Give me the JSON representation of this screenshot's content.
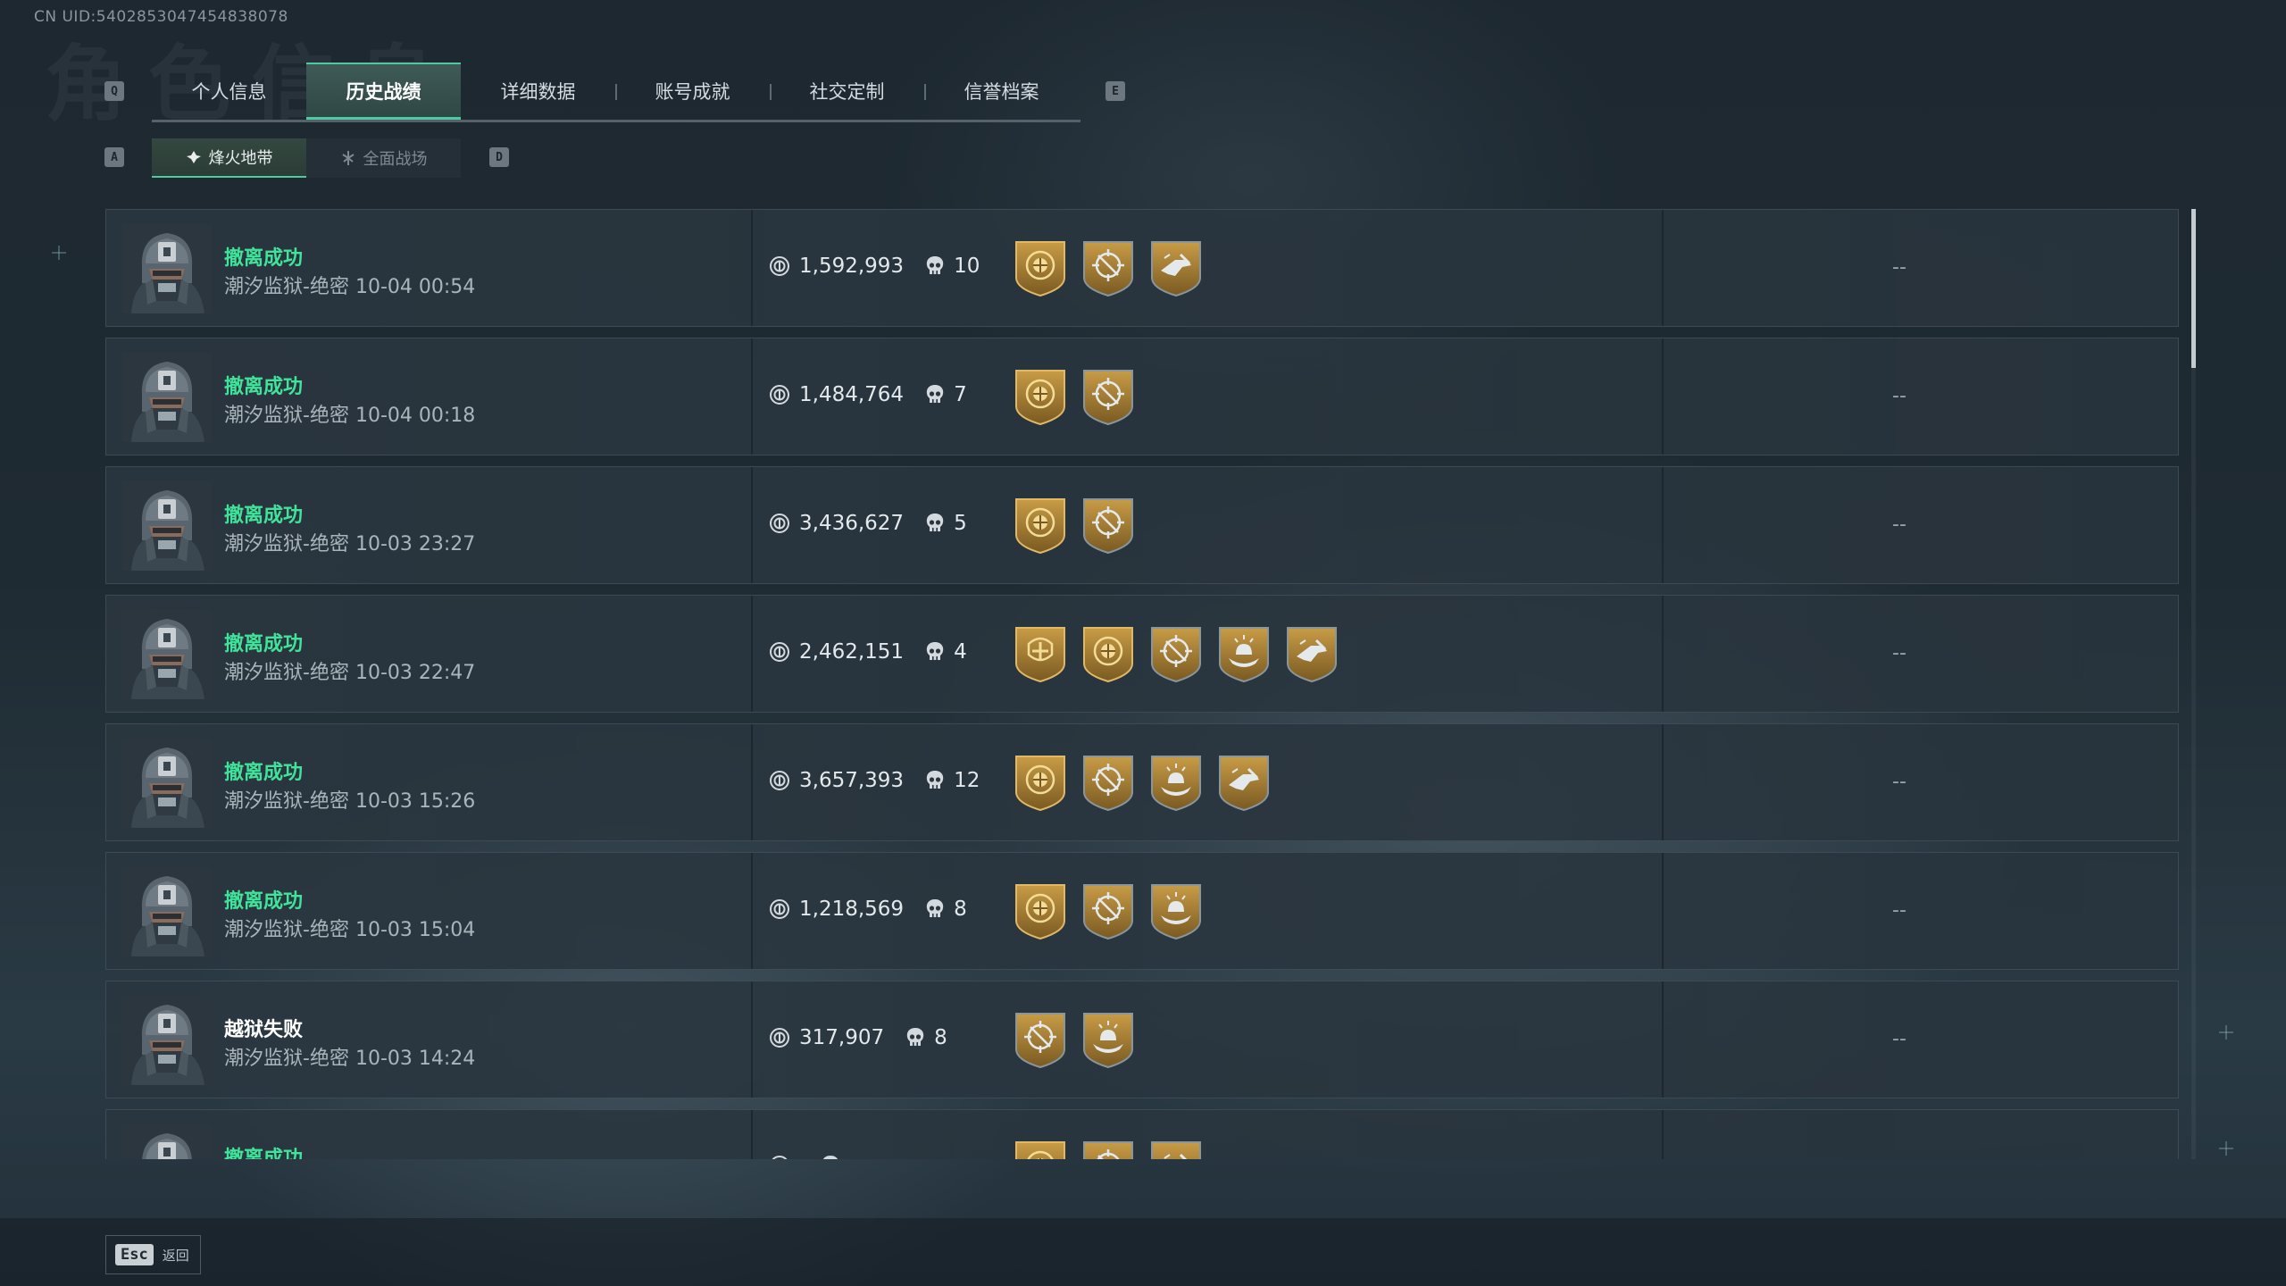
{
  "uid": "CN UID:5402853047454838078",
  "bg_title": "角色信息",
  "tabs": {
    "left_key": "Q",
    "right_key": "E",
    "items": [
      {
        "label": "个人信息"
      },
      {
        "label": "历史战绩",
        "active": true
      },
      {
        "label": "详细数据"
      },
      {
        "label": "账号成就"
      },
      {
        "label": "社交定制"
      },
      {
        "label": "信誉档案"
      }
    ]
  },
  "subtabs": {
    "left_key": "A",
    "right_key": "D",
    "items": [
      {
        "label": "烽火地带",
        "icon": "extraction-mode-icon",
        "active": true
      },
      {
        "label": "全面战场",
        "icon": "warfare-mode-icon"
      }
    ]
  },
  "matches": [
    {
      "status": "撤离成功",
      "success": true,
      "map": "潮汐监狱-绝密",
      "time": "10-04 00:54",
      "value": "1,592,993",
      "kills": "10",
      "badges": [
        "gold-shield-badge",
        "crosshair-badge",
        "combat-badge"
      ],
      "extra": "--"
    },
    {
      "status": "撤离成功",
      "success": true,
      "map": "潮汐监狱-绝密",
      "time": "10-04 00:18",
      "value": "1,484,764",
      "kills": "7",
      "badges": [
        "gold-shield-badge",
        "crosshair-badge"
      ],
      "extra": "--"
    },
    {
      "status": "撤离成功",
      "success": true,
      "map": "潮汐监狱-绝密",
      "time": "10-03 23:27",
      "value": "3,436,627",
      "kills": "5",
      "badges": [
        "gold-shield-badge",
        "crosshair-badge"
      ],
      "extra": "--"
    },
    {
      "status": "撤离成功",
      "success": true,
      "map": "潮汐监狱-绝密",
      "time": "10-03 22:47",
      "value": "2,462,151",
      "kills": "4",
      "badges": [
        "gold-medic-badge",
        "gold-shield-badge",
        "crosshair-badge",
        "hand-badge",
        "combat-badge"
      ],
      "extra": "--"
    },
    {
      "status": "撤离成功",
      "success": true,
      "map": "潮汐监狱-绝密",
      "time": "10-03 15:26",
      "value": "3,657,393",
      "kills": "12",
      "badges": [
        "gold-shield-badge",
        "crosshair-badge",
        "hand-badge",
        "combat-badge"
      ],
      "extra": "--"
    },
    {
      "status": "撤离成功",
      "success": true,
      "map": "潮汐监狱-绝密",
      "time": "10-03 15:04",
      "value": "1,218,569",
      "kills": "8",
      "badges": [
        "gold-shield-badge",
        "crosshair-badge",
        "hand-badge"
      ],
      "extra": "--"
    },
    {
      "status": "越狱失败",
      "success": false,
      "map": "潮汐监狱-绝密",
      "time": "10-03 14:24",
      "value": "317,907",
      "kills": "8",
      "badges": [
        "crosshair-badge",
        "hand-badge"
      ],
      "extra": "--"
    },
    {
      "status": "撤离成功",
      "success": true,
      "map": "",
      "time": "",
      "value": "",
      "kills": "",
      "badges": [
        "gold-shield-badge",
        "crosshair-badge",
        "combat-badge"
      ],
      "extra": ""
    }
  ],
  "footer": {
    "esc_key": "Esc",
    "back_label": "返回"
  },
  "colors": {
    "success": "#3fe39a",
    "fail": "#ffffff",
    "accent": "#4fc9a0",
    "gold": "#b08a3a"
  }
}
